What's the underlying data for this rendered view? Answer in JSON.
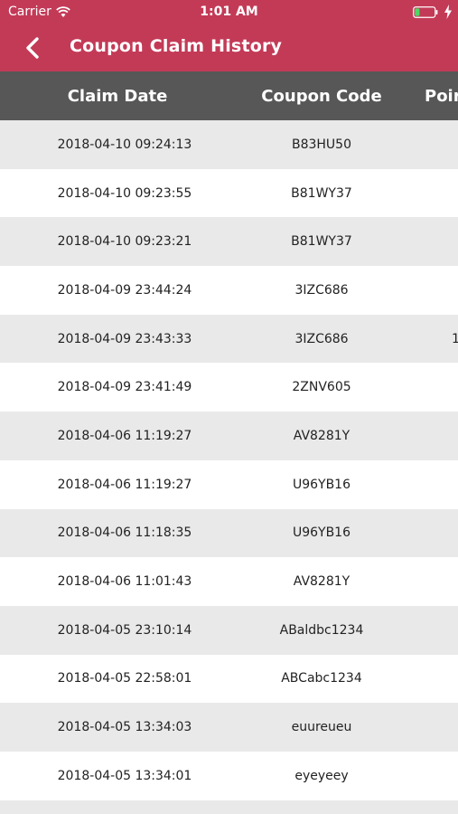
{
  "status_bar": {
    "carrier": "Carrier",
    "time": "1:01 AM"
  },
  "navbar": {
    "title": "Coupon Claim History"
  },
  "table": {
    "headers": {
      "date": "Claim Date",
      "code": "Coupon Code",
      "points": "Poir"
    },
    "rows": [
      {
        "date": "2018-04-10 09:24:13",
        "code": "B83HU50",
        "points": ""
      },
      {
        "date": "2018-04-10 09:23:55",
        "code": "B81WY37",
        "points": ""
      },
      {
        "date": "2018-04-10 09:23:21",
        "code": "B81WY37",
        "points": ""
      },
      {
        "date": "2018-04-09 23:44:24",
        "code": "3IZC686",
        "points": ""
      },
      {
        "date": "2018-04-09 23:43:33",
        "code": "3IZC686",
        "points": "1"
      },
      {
        "date": "2018-04-09 23:41:49",
        "code": "2ZNV605",
        "points": ""
      },
      {
        "date": "2018-04-06 11:19:27",
        "code": "AV8281Y",
        "points": ""
      },
      {
        "date": "2018-04-06 11:19:27",
        "code": "U96YB16",
        "points": ""
      },
      {
        "date": "2018-04-06 11:18:35",
        "code": "U96YB16",
        "points": ""
      },
      {
        "date": "2018-04-06 11:01:43",
        "code": "AV8281Y",
        "points": ""
      },
      {
        "date": "2018-04-05 23:10:14",
        "code": "ABaldbc1234",
        "points": ""
      },
      {
        "date": "2018-04-05 22:58:01",
        "code": "ABCabc1234",
        "points": ""
      },
      {
        "date": "2018-04-05 13:34:03",
        "code": "euureueu",
        "points": ""
      },
      {
        "date": "2018-04-05 13:34:01",
        "code": "eyeyeey",
        "points": ""
      },
      {
        "date": "",
        "code": "",
        "points": ""
      }
    ]
  },
  "colors": {
    "accent": "#c33a57",
    "header_bg": "#575757",
    "row_shade": "#e9e9e9"
  },
  "icons": {
    "back": "chevron-left-icon",
    "wifi": "wifi-icon",
    "battery": "battery-icon",
    "charging": "bolt-icon"
  }
}
